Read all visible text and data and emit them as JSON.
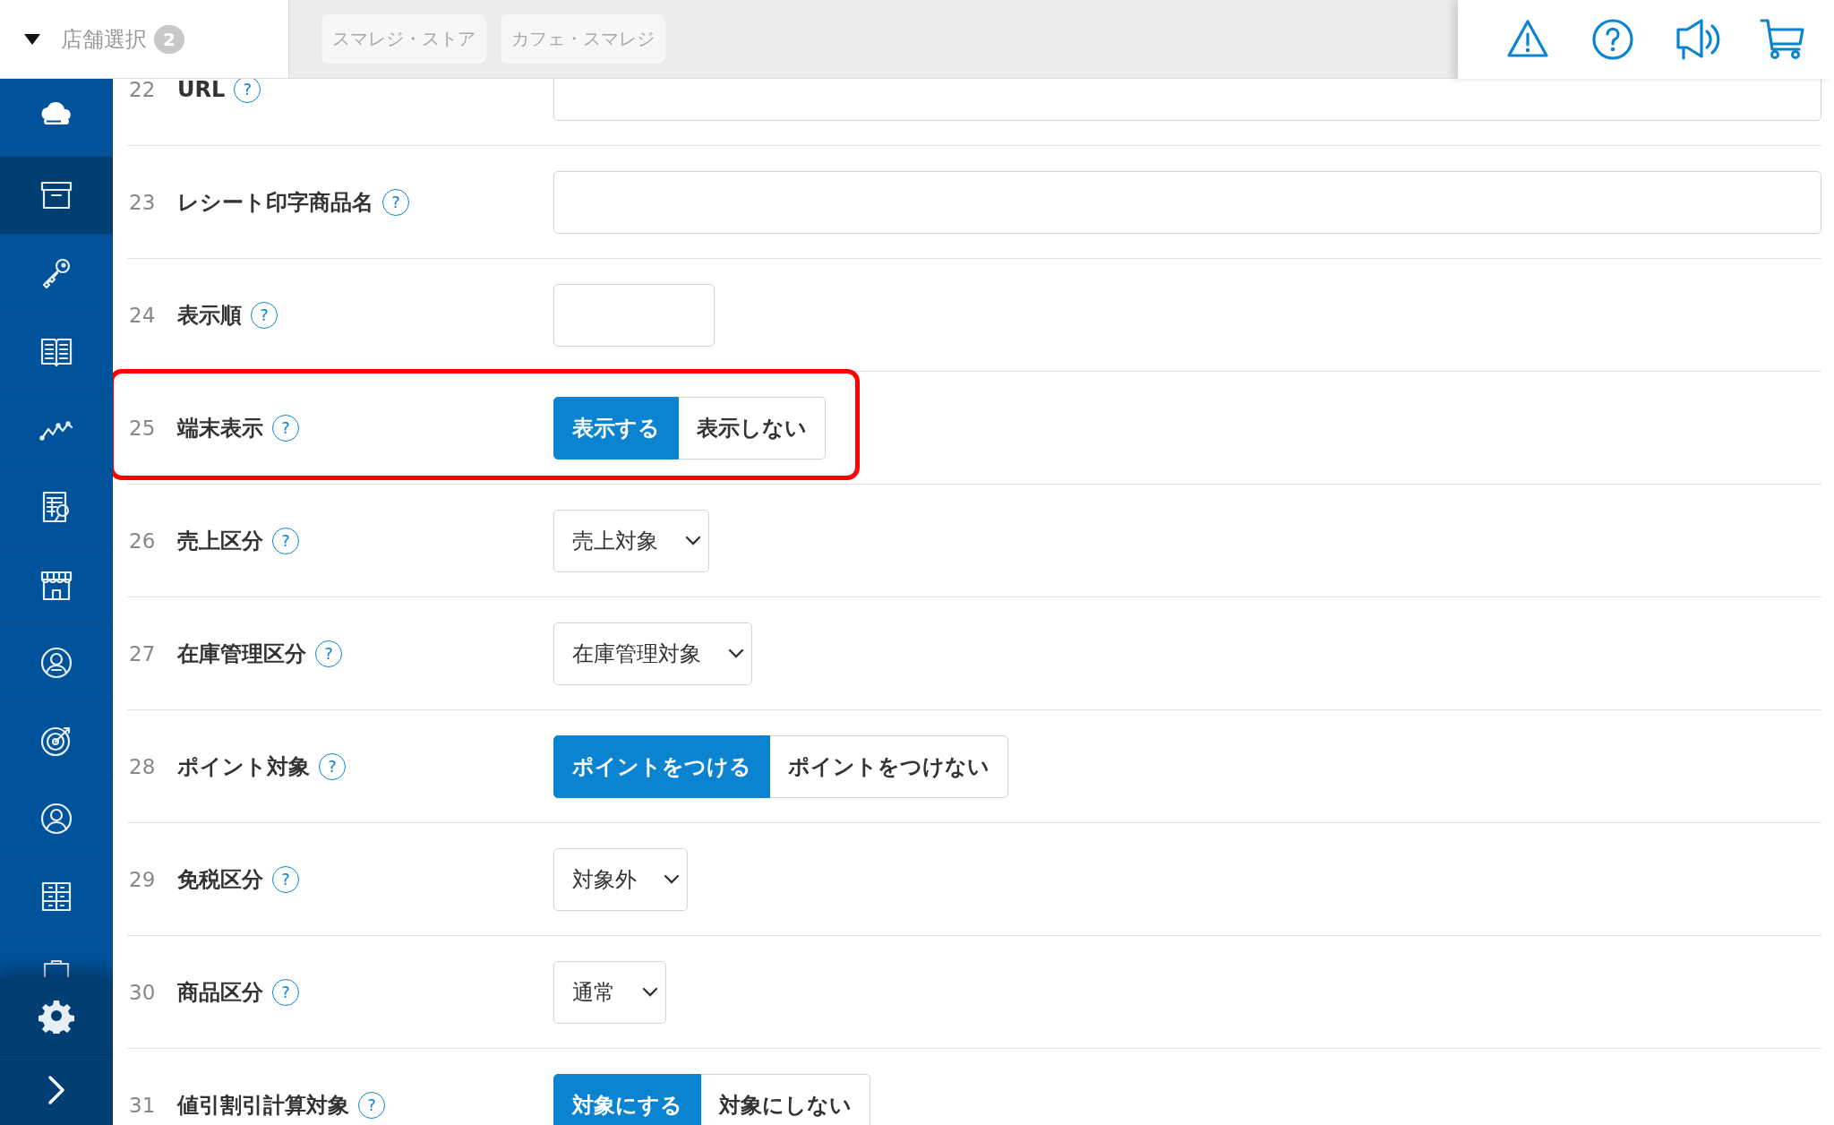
{
  "header": {
    "store_select": {
      "label": "店舗選択",
      "count": "2",
      "expanded": true
    },
    "stores": [
      "スマレジ・ストア",
      "カフェ・スマレジ"
    ]
  },
  "sidebar": {
    "items": [
      {
        "selected": false
      },
      {
        "selected": true
      },
      {
        "selected": false
      },
      {
        "selected": false
      },
      {
        "selected": false
      },
      {
        "selected": false
      },
      {
        "selected": false
      },
      {
        "selected": false
      },
      {
        "selected": false
      },
      {
        "selected": false
      },
      {
        "selected": false
      },
      {
        "selected": false
      }
    ]
  },
  "form": {
    "rows": [
      {
        "number": "22",
        "label": "URL",
        "help": "?",
        "kind": "wide-text",
        "highlighted": false
      },
      {
        "number": "23",
        "label": "レシート印字商品名",
        "help": "?",
        "kind": "wide-text",
        "highlighted": false
      },
      {
        "number": "24",
        "label": "表示順",
        "help": "?",
        "kind": "short-text",
        "highlighted": false
      },
      {
        "number": "25",
        "label": "端末表示",
        "help": "?",
        "kind": "toggle",
        "highlighted": true,
        "options": [
          {
            "label": "表示する",
            "selected": true
          },
          {
            "label": "表示しない",
            "selected": false
          }
        ]
      },
      {
        "number": "26",
        "label": "売上区分",
        "help": "?",
        "kind": "select",
        "highlighted": false,
        "value": "売上対象"
      },
      {
        "number": "27",
        "label": "在庫管理区分",
        "help": "?",
        "kind": "select",
        "highlighted": false,
        "value": "在庫管理対象"
      },
      {
        "number": "28",
        "label": "ポイント対象",
        "help": "?",
        "kind": "toggle",
        "highlighted": false,
        "options": [
          {
            "label": "ポイントをつける",
            "selected": true
          },
          {
            "label": "ポイントをつけない",
            "selected": false
          }
        ]
      },
      {
        "number": "29",
        "label": "免税区分",
        "help": "?",
        "kind": "select",
        "highlighted": false,
        "value": "対象外"
      },
      {
        "number": "30",
        "label": "商品区分",
        "help": "?",
        "kind": "select",
        "highlighted": false,
        "value": "通常"
      },
      {
        "number": "31",
        "label": "値引割引計算対象",
        "help": "?",
        "kind": "toggle",
        "highlighted": false,
        "options": [
          {
            "label": "対象にする",
            "selected": true
          },
          {
            "label": "対象にしない",
            "selected": false
          }
        ]
      }
    ]
  }
}
